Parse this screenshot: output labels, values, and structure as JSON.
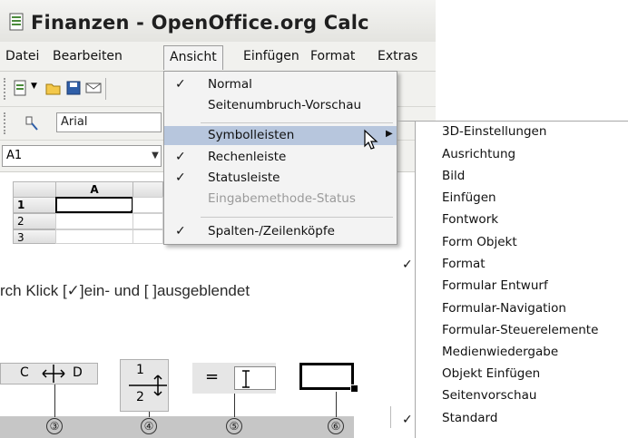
{
  "window": {
    "title": "Finanzen - OpenOffice.org Calc",
    "icon": "calc-app-icon"
  },
  "menubar": {
    "items": [
      {
        "label": "Datei",
        "active": false
      },
      {
        "label": "Bearbeiten",
        "active": false
      },
      {
        "label": "Ansicht",
        "active": true
      },
      {
        "label": "Einfügen",
        "active": false
      },
      {
        "label": "Format",
        "active": false
      },
      {
        "label": "Extras",
        "active": false
      }
    ]
  },
  "toolbar": {
    "font_name": "Arial",
    "icons": [
      "new-document-icon",
      "open-folder-icon",
      "save-icon",
      "email-icon",
      "stylist-icon"
    ]
  },
  "namebox": {
    "value": "A1"
  },
  "grid": {
    "columns": [
      "A"
    ],
    "rows": [
      "1",
      "2",
      "3"
    ]
  },
  "view_menu": {
    "items": [
      {
        "label": "Normal",
        "checked": true,
        "disabled": false
      },
      {
        "label": "Seitenumbruch-Vorschau",
        "checked": false,
        "disabled": false
      },
      {
        "label": "Symbolleisten",
        "checked": false,
        "disabled": false,
        "submenu": true,
        "highlighted": true
      },
      {
        "label": "Rechenleiste",
        "checked": true,
        "disabled": false
      },
      {
        "label": "Statusleiste",
        "checked": true,
        "disabled": false
      },
      {
        "label": "Eingabemethode-Status",
        "checked": false,
        "disabled": true
      },
      {
        "label": "Spalten-/Zeilenköpfe",
        "checked": true,
        "disabled": false
      }
    ]
  },
  "toolbars_submenu": {
    "items": [
      {
        "label": "3D-Einstellungen",
        "checked": false
      },
      {
        "label": "Ausrichtung",
        "checked": false
      },
      {
        "label": "Bild",
        "checked": false
      },
      {
        "label": "Einfügen",
        "checked": false
      },
      {
        "label": "Fontwork",
        "checked": false
      },
      {
        "label": "Form Objekt",
        "checked": false
      },
      {
        "label": "Format",
        "checked": true
      },
      {
        "label": "Formular Entwurf",
        "checked": false
      },
      {
        "label": "Formular-Navigation",
        "checked": false
      },
      {
        "label": "Formular-Steuerelemente",
        "checked": false
      },
      {
        "label": "Medienwiedergabe",
        "checked": false
      },
      {
        "label": "Objekt Einfügen",
        "checked": false
      },
      {
        "label": "Seitenvorschau",
        "checked": false
      },
      {
        "label": "Standard",
        "checked": true
      }
    ]
  },
  "hint_text": "rch Klick [✓]ein- und [  ]ausgeblendet",
  "illustrations": {
    "col_resize_label_left": "C",
    "col_resize_label_right": "D",
    "row_resize_top": "1",
    "row_resize_bottom": "2",
    "formula_equals": "=",
    "callouts": [
      "③",
      "④",
      "⑤",
      "⑥"
    ]
  },
  "colors": {
    "menu_bg": "#f3f3f3",
    "highlight": "#b7c6dd",
    "disabled_text": "#9a9a9a",
    "strip": "#c6c6c6"
  }
}
